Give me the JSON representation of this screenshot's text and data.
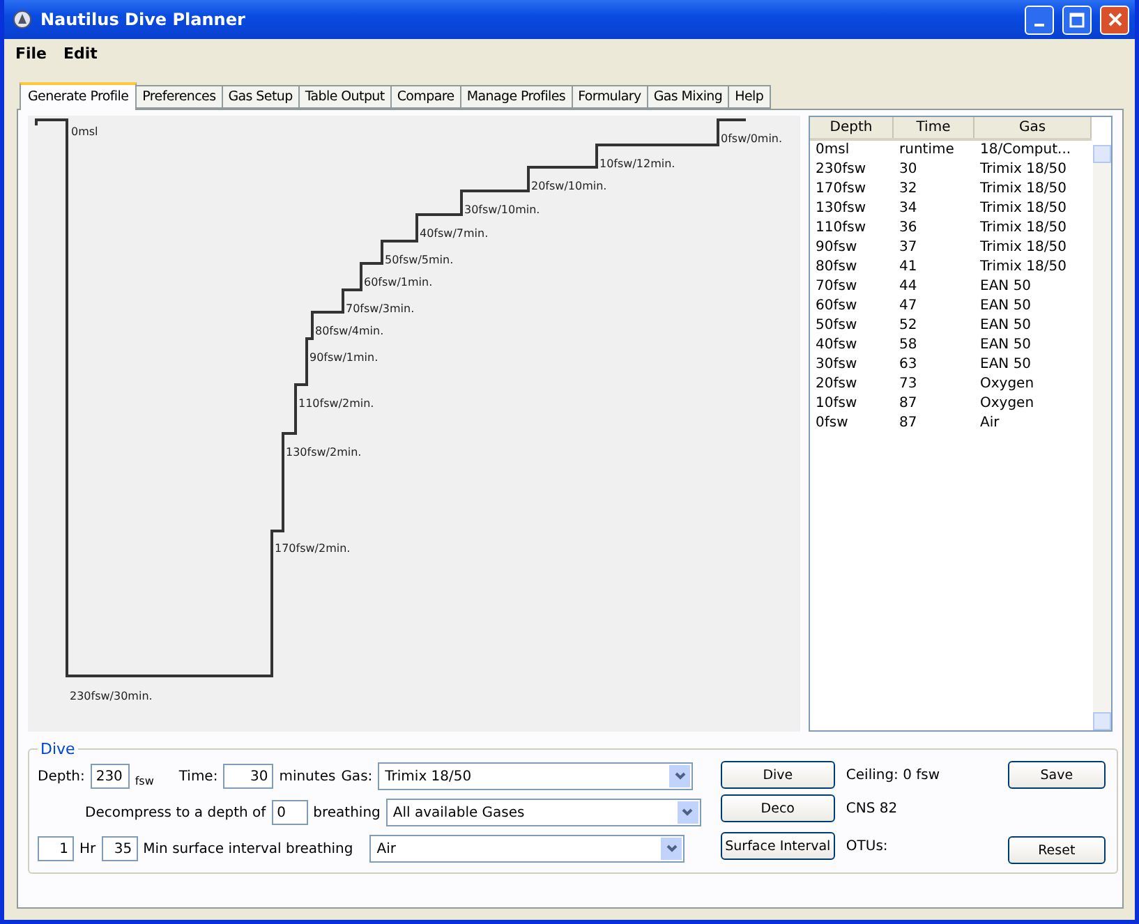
{
  "window": {
    "title": "Nautilus Dive Planner"
  },
  "menu": [
    "File",
    "Edit"
  ],
  "tabs": [
    {
      "label": "Generate Profile",
      "selected": true
    },
    {
      "label": "Preferences",
      "selected": false
    },
    {
      "label": "Gas Setup",
      "selected": false
    },
    {
      "label": "Table Output",
      "selected": false
    },
    {
      "label": "Compare",
      "selected": false
    },
    {
      "label": "Manage Profiles",
      "selected": false
    },
    {
      "label": "Formulary",
      "selected": false
    },
    {
      "label": "Gas Mixing",
      "selected": false
    },
    {
      "label": "Help",
      "selected": false
    }
  ],
  "profile": {
    "surface_label": "0msl",
    "stops": [
      "0fsw/0min.",
      "10fsw/12min.",
      "20fsw/10min.",
      "30fsw/10min.",
      "40fsw/7min.",
      "50fsw/5min.",
      "60fsw/1min.",
      "70fsw/3min.",
      "80fsw/4min.",
      "90fsw/1min.",
      "110fsw/2min.",
      "130fsw/2min.",
      "170fsw/2min.",
      "230fsw/30min."
    ]
  },
  "table": {
    "columns": [
      "Depth",
      "Time",
      "Gas"
    ],
    "rows": [
      [
        "0msl",
        "runtime",
        "18/Comput..."
      ],
      [
        "230fsw",
        "30",
        "Trimix 18/50"
      ],
      [
        "170fsw",
        "32",
        "Trimix 18/50"
      ],
      [
        "130fsw",
        "34",
        "Trimix 18/50"
      ],
      [
        "110fsw",
        "36",
        "Trimix 18/50"
      ],
      [
        "90fsw",
        "37",
        "Trimix 18/50"
      ],
      [
        "80fsw",
        "41",
        "Trimix 18/50"
      ],
      [
        "70fsw",
        "44",
        "EAN 50"
      ],
      [
        "60fsw",
        "47",
        "EAN 50"
      ],
      [
        "50fsw",
        "52",
        "EAN 50"
      ],
      [
        "40fsw",
        "58",
        "EAN 50"
      ],
      [
        "30fsw",
        "63",
        "EAN 50"
      ],
      [
        "20fsw",
        "73",
        "Oxygen"
      ],
      [
        "10fsw",
        "87",
        "Oxygen"
      ],
      [
        "0fsw",
        "87",
        "Air"
      ]
    ]
  },
  "dive": {
    "group_label": "Dive",
    "depth_label": "Depth:",
    "depth_value": "230",
    "depth_unit": "fsw",
    "time_label": "Time:",
    "time_value": "30",
    "time_unit": "minutes",
    "gas_label": "Gas:",
    "gas": "Trimix 18/50",
    "decompress_label": "Decompress to a depth of",
    "decompress_value": "0",
    "breathing_label": "breathing",
    "decompress_gas": "All available Gases",
    "hours_value": "1",
    "hours_label": "Hr",
    "minutes_value": "35",
    "surface_label": "Min surface interval breathing",
    "surface_gas": "Air"
  },
  "actions": [
    "Dive",
    "Deco",
    "Surface Interval"
  ],
  "readouts": [
    "Ceiling: 0 fsw",
    "CNS 82",
    "OTUs:"
  ],
  "side_buttons": [
    "Save",
    "Reset"
  ]
}
